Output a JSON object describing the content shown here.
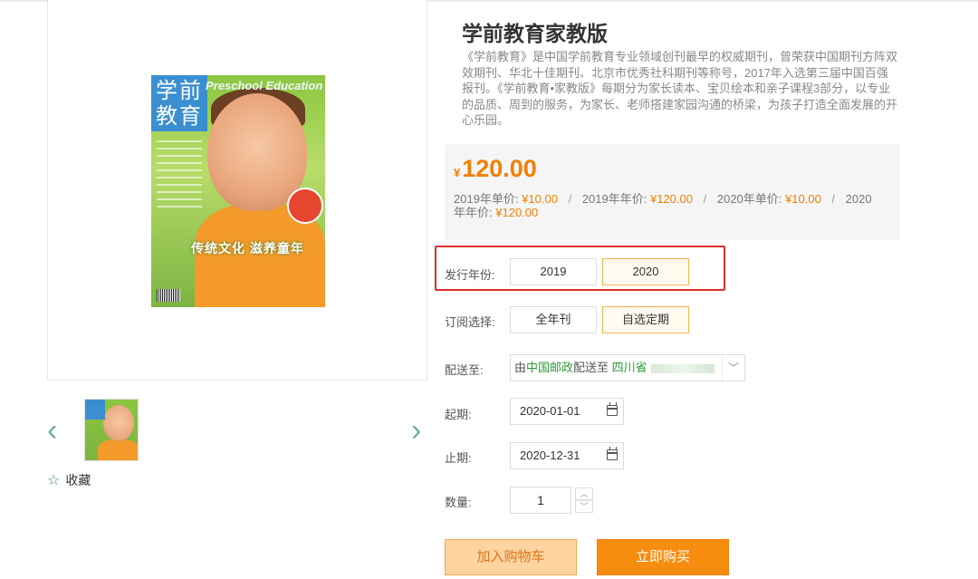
{
  "product": {
    "title": "学前教育家教版",
    "description": "《学前教育》是中国学前教育专业领域创刊最早的权威期刊，曾荣获中国期刊方阵双效期刊、华北十佳期刊、北京市优秀社科期刊等称号，2017年入选第三届中国百强报刊。《学前教育•家教版》每期分为家长读本、宝贝绘本和亲子课程3部分，以专业的品质、周到的服务，为家长、老师搭建家园沟通的桥梁，为孩子打造全面发展的开心乐园。",
    "currency_symbol": "¥",
    "price": "120.00",
    "price_list": [
      {
        "label": "2019年单价:",
        "value": "¥10.00"
      },
      {
        "label": "2019年年价:",
        "value": "¥120.00"
      },
      {
        "label": "2020年单价:",
        "value": "¥10.00"
      },
      {
        "label": "2020年年价:",
        "value": "¥120.00"
      }
    ],
    "separator": "/"
  },
  "cover": {
    "logo_text": "学前教育",
    "english_title": "Preschool Education",
    "banner_text": "传统文化 滋养童年"
  },
  "gallery": {
    "prev_icon": "‹",
    "next_icon": "›",
    "favorite_icon": "☆",
    "favorite_label": "收藏"
  },
  "options": {
    "year_label": "发行年份:",
    "years": [
      "2019",
      "2020"
    ],
    "selected_year": "2020",
    "subscription_label": "订阅选择:",
    "subscriptions": [
      "全年刊",
      "自选定期"
    ],
    "selected_subscription": "自选定期"
  },
  "shipping": {
    "label": "配送至:",
    "prefix": "由",
    "carrier": "中国邮政",
    "middle": "配送至",
    "province": "四川省",
    "dropdown_icon": "﹀"
  },
  "dates": {
    "start_label": "起期:",
    "start_value": "2020-01-01",
    "end_label": "止期:",
    "end_value": "2020-12-31"
  },
  "quantity": {
    "label": "数量:",
    "value": "1",
    "up_icon": "︿",
    "down_icon": "﹀"
  },
  "actions": {
    "add_to_cart": "加入购物车",
    "buy_now": "立即购买"
  },
  "colors": {
    "accent_orange": "#f27f00",
    "buy_button": "#f78d0e",
    "highlight_red": "#d9312a",
    "carrier_green": "#2c9a3a"
  }
}
